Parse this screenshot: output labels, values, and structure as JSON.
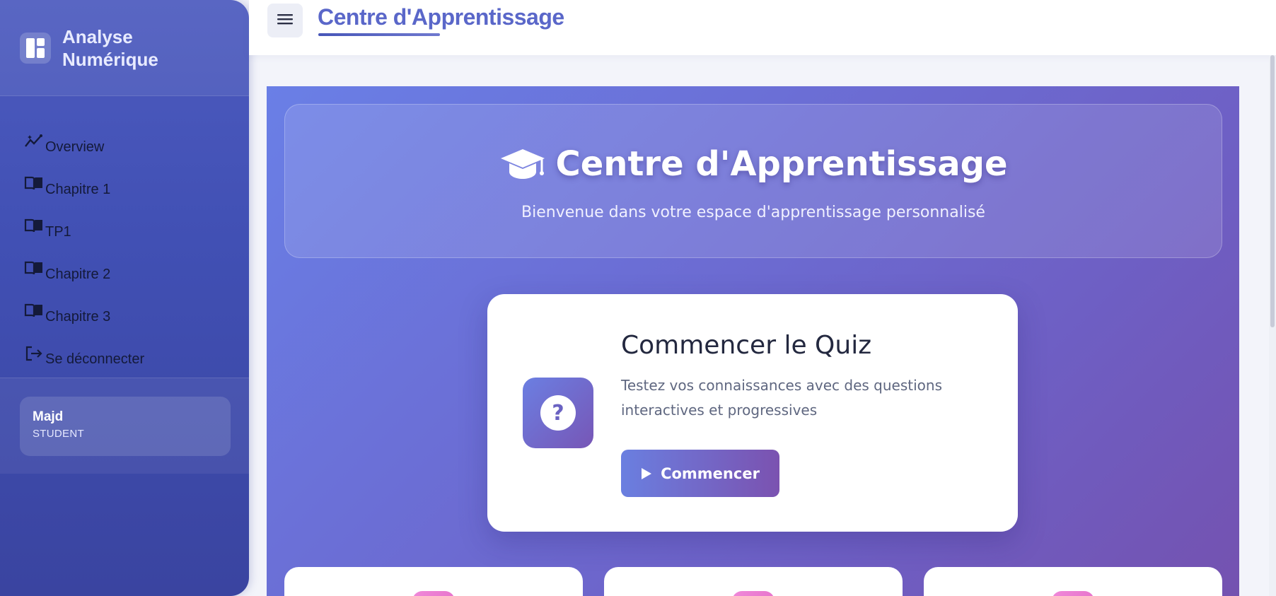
{
  "brand": {
    "name_line1": "Analyse",
    "name_line2": "Numérique"
  },
  "sidebar": {
    "items": [
      {
        "label": "Overview",
        "icon": "chart-line-icon"
      },
      {
        "label": "Chapitre 1",
        "icon": "book-open-icon"
      },
      {
        "label": "TP1",
        "icon": "book-open-icon"
      },
      {
        "label": "Chapitre 2",
        "icon": "book-open-icon"
      },
      {
        "label": "Chapitre 3",
        "icon": "book-open-icon"
      },
      {
        "label": "Se déconnecter",
        "icon": "logout-icon"
      }
    ]
  },
  "user": {
    "name": "Majd",
    "role": "STUDENT"
  },
  "topbar": {
    "title": "Centre d'Apprentissage",
    "menu_icon": "hamburger-menu-icon"
  },
  "hero": {
    "title": "Centre d'Apprentissage",
    "subtitle": "Bienvenue dans votre espace d'apprentissage personnalisé",
    "icon": "graduation-cap-icon"
  },
  "quiz": {
    "title": "Commencer le Quiz",
    "description": "Testez vos connaissances avec des questions interactives et progressives",
    "button_label": "Commencer",
    "icon_glyph": "?"
  },
  "colors": {
    "sidebar": "#4150b4",
    "accent": "#5a67c9",
    "gradient_start": "#6a7fe6",
    "gradient_end": "#7452b0",
    "badge_pink": "#e46ec8"
  }
}
